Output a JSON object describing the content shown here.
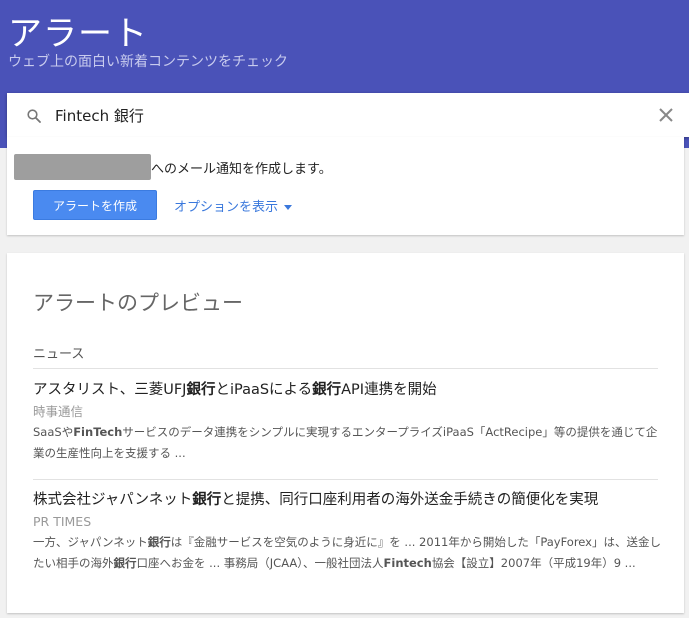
{
  "header": {
    "title": "アラート",
    "subtitle": "ウェブ上の面白い新着コンテンツをチェック"
  },
  "search": {
    "value": "Fintech 銀行"
  },
  "create_card": {
    "notify_text": "へのメール通知を作成します。",
    "create_button": "アラートを作成",
    "options_link": "オプションを表示"
  },
  "preview": {
    "title": "アラートのプレビュー",
    "section_label": "ニュース",
    "items": [
      {
        "title_parts": [
          "アスタリスト、三菱UFJ",
          "銀行",
          "とiPaaSによる",
          "銀行",
          "API連携を開始"
        ],
        "source": "時事通信",
        "snippet_parts": [
          "SaaSや",
          "FinTech",
          "サービスのデータ連携をシンプルに実現するエンタープライズiPaaS「ActRecipe」等の提供を通じて企業の生産性向上を支援する ..."
        ]
      },
      {
        "title_parts": [
          "株式会社ジャパンネット",
          "銀行",
          "と提携、同行口座利用者の海外送金手続きの簡便化を実現"
        ],
        "source": "PR TIMES",
        "snippet_parts": [
          "一方、ジャパンネット",
          "銀行",
          "は『金融サービスを空気のように身近に』を ... 2011年から開始した「PayForex」は、送金したい相手の海外",
          "銀行",
          "口座へお金を ... 事務局（JCAA）、一般社団法人",
          "Fintech",
          "協会【設立】2007年（平成19年）9 ..."
        ]
      }
    ]
  },
  "colors": {
    "header_bg": "#4a52b8",
    "button_bg": "#4a8af0",
    "link": "#3a78dc"
  }
}
